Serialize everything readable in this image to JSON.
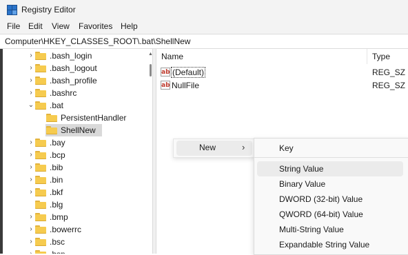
{
  "window": {
    "title": "Registry Editor"
  },
  "menu": [
    "File",
    "Edit",
    "View",
    "Favorites",
    "Help"
  ],
  "address": "Computer\\HKEY_CLASSES_ROOT\\.bat\\ShellNew",
  "tree": [
    {
      "label": ".bash_login",
      "chevron": "›"
    },
    {
      "label": ".bash_logout",
      "chevron": "›"
    },
    {
      "label": ".bash_profile",
      "chevron": "›"
    },
    {
      "label": ".bashrc",
      "chevron": "›"
    },
    {
      "label": ".bat",
      "chevron": "⌄"
    },
    {
      "label": "PersistentHandler",
      "chevron": ""
    },
    {
      "label": "ShellNew",
      "chevron": ""
    },
    {
      "label": ".bay",
      "chevron": "›"
    },
    {
      "label": ".bcp",
      "chevron": "›"
    },
    {
      "label": ".bib",
      "chevron": "›"
    },
    {
      "label": ".bin",
      "chevron": "›"
    },
    {
      "label": ".bkf",
      "chevron": "›"
    },
    {
      "label": ".blg",
      "chevron": ""
    },
    {
      "label": ".bmp",
      "chevron": "›"
    },
    {
      "label": ".bowerrc",
      "chevron": "›"
    },
    {
      "label": ".bsc",
      "chevron": "›"
    },
    {
      "label": ".bsp",
      "chevron": "›"
    }
  ],
  "values": {
    "headers": {
      "name": "Name",
      "type": "Type"
    },
    "rows": [
      {
        "name": "(Default)",
        "type": "REG_SZ",
        "icon": "ab"
      },
      {
        "name": "NullFile",
        "type": "REG_SZ",
        "icon": "ab"
      }
    ]
  },
  "context_menu": {
    "new_label": "New",
    "arrow": "›"
  },
  "submenu": {
    "items": [
      "Key",
      "String Value",
      "Binary Value",
      "DWORD (32-bit) Value",
      "QWORD (64-bit) Value",
      "Multi-String Value",
      "Expandable String Value"
    ]
  },
  "colors": {
    "folder": "#f6cb4f",
    "selection": "#d9d9d9",
    "menu_hover": "#ebebeb"
  }
}
